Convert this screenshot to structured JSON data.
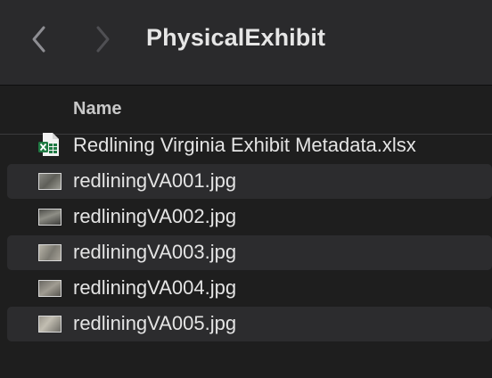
{
  "window": {
    "title": "PhysicalExhibit",
    "back_icon": "chevron-left-icon",
    "forward_icon": "chevron-right-icon"
  },
  "list": {
    "column_header": "Name",
    "files": [
      {
        "name": "Redlining Virginia Exhibit Metadata.xlsx",
        "icon": "excel-file-icon",
        "striped": false
      },
      {
        "name": "redliningVA001.jpg",
        "icon": "image-thumbnail-icon",
        "striped": true
      },
      {
        "name": "redliningVA002.jpg",
        "icon": "image-thumbnail-icon",
        "striped": false
      },
      {
        "name": "redliningVA003.jpg",
        "icon": "image-thumbnail-icon",
        "striped": true
      },
      {
        "name": "redliningVA004.jpg",
        "icon": "image-thumbnail-icon",
        "striped": false
      },
      {
        "name": "redliningVA005.jpg",
        "icon": "image-thumbnail-icon",
        "striped": true
      }
    ]
  },
  "colors": {
    "window_bg": "#1e1e1e",
    "titlebar_bg": "#2a2a2c",
    "stripe_bg": "#2c2c2e",
    "text": "#e4e4e4",
    "excel_green": "#1f7a43"
  }
}
